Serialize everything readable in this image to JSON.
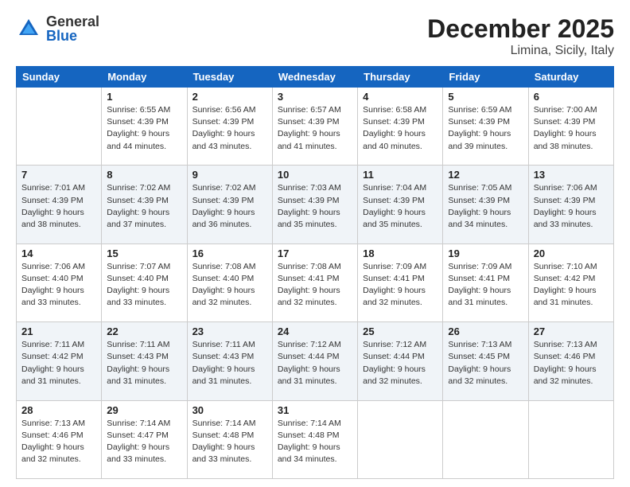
{
  "header": {
    "logo_general": "General",
    "logo_blue": "Blue",
    "main_title": "December 2025",
    "subtitle": "Limina, Sicily, Italy"
  },
  "calendar": {
    "days_of_week": [
      "Sunday",
      "Monday",
      "Tuesday",
      "Wednesday",
      "Thursday",
      "Friday",
      "Saturday"
    ],
    "weeks": [
      [
        {
          "day": "",
          "info": ""
        },
        {
          "day": "1",
          "info": "Sunrise: 6:55 AM\nSunset: 4:39 PM\nDaylight: 9 hours\nand 44 minutes."
        },
        {
          "day": "2",
          "info": "Sunrise: 6:56 AM\nSunset: 4:39 PM\nDaylight: 9 hours\nand 43 minutes."
        },
        {
          "day": "3",
          "info": "Sunrise: 6:57 AM\nSunset: 4:39 PM\nDaylight: 9 hours\nand 41 minutes."
        },
        {
          "day": "4",
          "info": "Sunrise: 6:58 AM\nSunset: 4:39 PM\nDaylight: 9 hours\nand 40 minutes."
        },
        {
          "day": "5",
          "info": "Sunrise: 6:59 AM\nSunset: 4:39 PM\nDaylight: 9 hours\nand 39 minutes."
        },
        {
          "day": "6",
          "info": "Sunrise: 7:00 AM\nSunset: 4:39 PM\nDaylight: 9 hours\nand 38 minutes."
        }
      ],
      [
        {
          "day": "7",
          "info": "Sunrise: 7:01 AM\nSunset: 4:39 PM\nDaylight: 9 hours\nand 38 minutes."
        },
        {
          "day": "8",
          "info": "Sunrise: 7:02 AM\nSunset: 4:39 PM\nDaylight: 9 hours\nand 37 minutes."
        },
        {
          "day": "9",
          "info": "Sunrise: 7:02 AM\nSunset: 4:39 PM\nDaylight: 9 hours\nand 36 minutes."
        },
        {
          "day": "10",
          "info": "Sunrise: 7:03 AM\nSunset: 4:39 PM\nDaylight: 9 hours\nand 35 minutes."
        },
        {
          "day": "11",
          "info": "Sunrise: 7:04 AM\nSunset: 4:39 PM\nDaylight: 9 hours\nand 35 minutes."
        },
        {
          "day": "12",
          "info": "Sunrise: 7:05 AM\nSunset: 4:39 PM\nDaylight: 9 hours\nand 34 minutes."
        },
        {
          "day": "13",
          "info": "Sunrise: 7:06 AM\nSunset: 4:39 PM\nDaylight: 9 hours\nand 33 minutes."
        }
      ],
      [
        {
          "day": "14",
          "info": "Sunrise: 7:06 AM\nSunset: 4:40 PM\nDaylight: 9 hours\nand 33 minutes."
        },
        {
          "day": "15",
          "info": "Sunrise: 7:07 AM\nSunset: 4:40 PM\nDaylight: 9 hours\nand 33 minutes."
        },
        {
          "day": "16",
          "info": "Sunrise: 7:08 AM\nSunset: 4:40 PM\nDaylight: 9 hours\nand 32 minutes."
        },
        {
          "day": "17",
          "info": "Sunrise: 7:08 AM\nSunset: 4:41 PM\nDaylight: 9 hours\nand 32 minutes."
        },
        {
          "day": "18",
          "info": "Sunrise: 7:09 AM\nSunset: 4:41 PM\nDaylight: 9 hours\nand 32 minutes."
        },
        {
          "day": "19",
          "info": "Sunrise: 7:09 AM\nSunset: 4:41 PM\nDaylight: 9 hours\nand 31 minutes."
        },
        {
          "day": "20",
          "info": "Sunrise: 7:10 AM\nSunset: 4:42 PM\nDaylight: 9 hours\nand 31 minutes."
        }
      ],
      [
        {
          "day": "21",
          "info": "Sunrise: 7:11 AM\nSunset: 4:42 PM\nDaylight: 9 hours\nand 31 minutes."
        },
        {
          "day": "22",
          "info": "Sunrise: 7:11 AM\nSunset: 4:43 PM\nDaylight: 9 hours\nand 31 minutes."
        },
        {
          "day": "23",
          "info": "Sunrise: 7:11 AM\nSunset: 4:43 PM\nDaylight: 9 hours\nand 31 minutes."
        },
        {
          "day": "24",
          "info": "Sunrise: 7:12 AM\nSunset: 4:44 PM\nDaylight: 9 hours\nand 31 minutes."
        },
        {
          "day": "25",
          "info": "Sunrise: 7:12 AM\nSunset: 4:44 PM\nDaylight: 9 hours\nand 32 minutes."
        },
        {
          "day": "26",
          "info": "Sunrise: 7:13 AM\nSunset: 4:45 PM\nDaylight: 9 hours\nand 32 minutes."
        },
        {
          "day": "27",
          "info": "Sunrise: 7:13 AM\nSunset: 4:46 PM\nDaylight: 9 hours\nand 32 minutes."
        }
      ],
      [
        {
          "day": "28",
          "info": "Sunrise: 7:13 AM\nSunset: 4:46 PM\nDaylight: 9 hours\nand 32 minutes."
        },
        {
          "day": "29",
          "info": "Sunrise: 7:14 AM\nSunset: 4:47 PM\nDaylight: 9 hours\nand 33 minutes."
        },
        {
          "day": "30",
          "info": "Sunrise: 7:14 AM\nSunset: 4:48 PM\nDaylight: 9 hours\nand 33 minutes."
        },
        {
          "day": "31",
          "info": "Sunrise: 7:14 AM\nSunset: 4:48 PM\nDaylight: 9 hours\nand 34 minutes."
        },
        {
          "day": "",
          "info": ""
        },
        {
          "day": "",
          "info": ""
        },
        {
          "day": "",
          "info": ""
        }
      ]
    ]
  }
}
